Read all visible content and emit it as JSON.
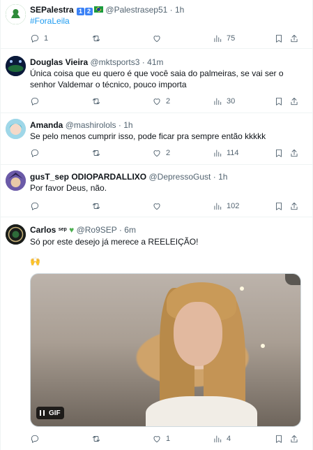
{
  "tweets": [
    {
      "display_name": "SEPalestra",
      "badges": [
        "1",
        "2"
      ],
      "handle": "@Palestrasep51",
      "time": "1h",
      "text": "#ForaLeila",
      "counts": {
        "reply": "1",
        "retweet": "",
        "like": "",
        "views": "75"
      }
    },
    {
      "display_name": "Douglas Vieira",
      "handle": "@mktsports3",
      "time": "41m",
      "text": "Única coisa que eu quero é que você saia do palmeiras, se vai ser o senhor Valdemar o técnico, pouco importa",
      "counts": {
        "reply": "",
        "retweet": "",
        "like": "2",
        "views": "30"
      }
    },
    {
      "display_name": "Amanda",
      "handle": "@mashirolols",
      "time": "1h",
      "text": "Se pelo menos cumprir isso, pode ficar pra sempre então kkkkk",
      "counts": {
        "reply": "",
        "retweet": "",
        "like": "2",
        "views": "114"
      }
    },
    {
      "display_name": "gusT_sep ODIOPARDALLIXO",
      "handle": "@DepressoGust",
      "time": "1h",
      "text": "Por favor Deus, não.",
      "counts": {
        "reply": "",
        "retweet": "",
        "like": "",
        "views": "102"
      }
    },
    {
      "display_name": "Carlos",
      "name_suffix": "sep",
      "handle": "@Ro9SEP",
      "time": "6m",
      "text": "Só por este desejo já merece a REELEIÇÃO!",
      "emoji": "🙌",
      "gif_label": "GIF",
      "counts": {
        "reply": "",
        "retweet": "",
        "like": "1",
        "views": "4"
      }
    }
  ],
  "colors": {
    "hashtag": "#1d9bf0",
    "muted": "#536471",
    "green_heart": "#4caf50"
  }
}
